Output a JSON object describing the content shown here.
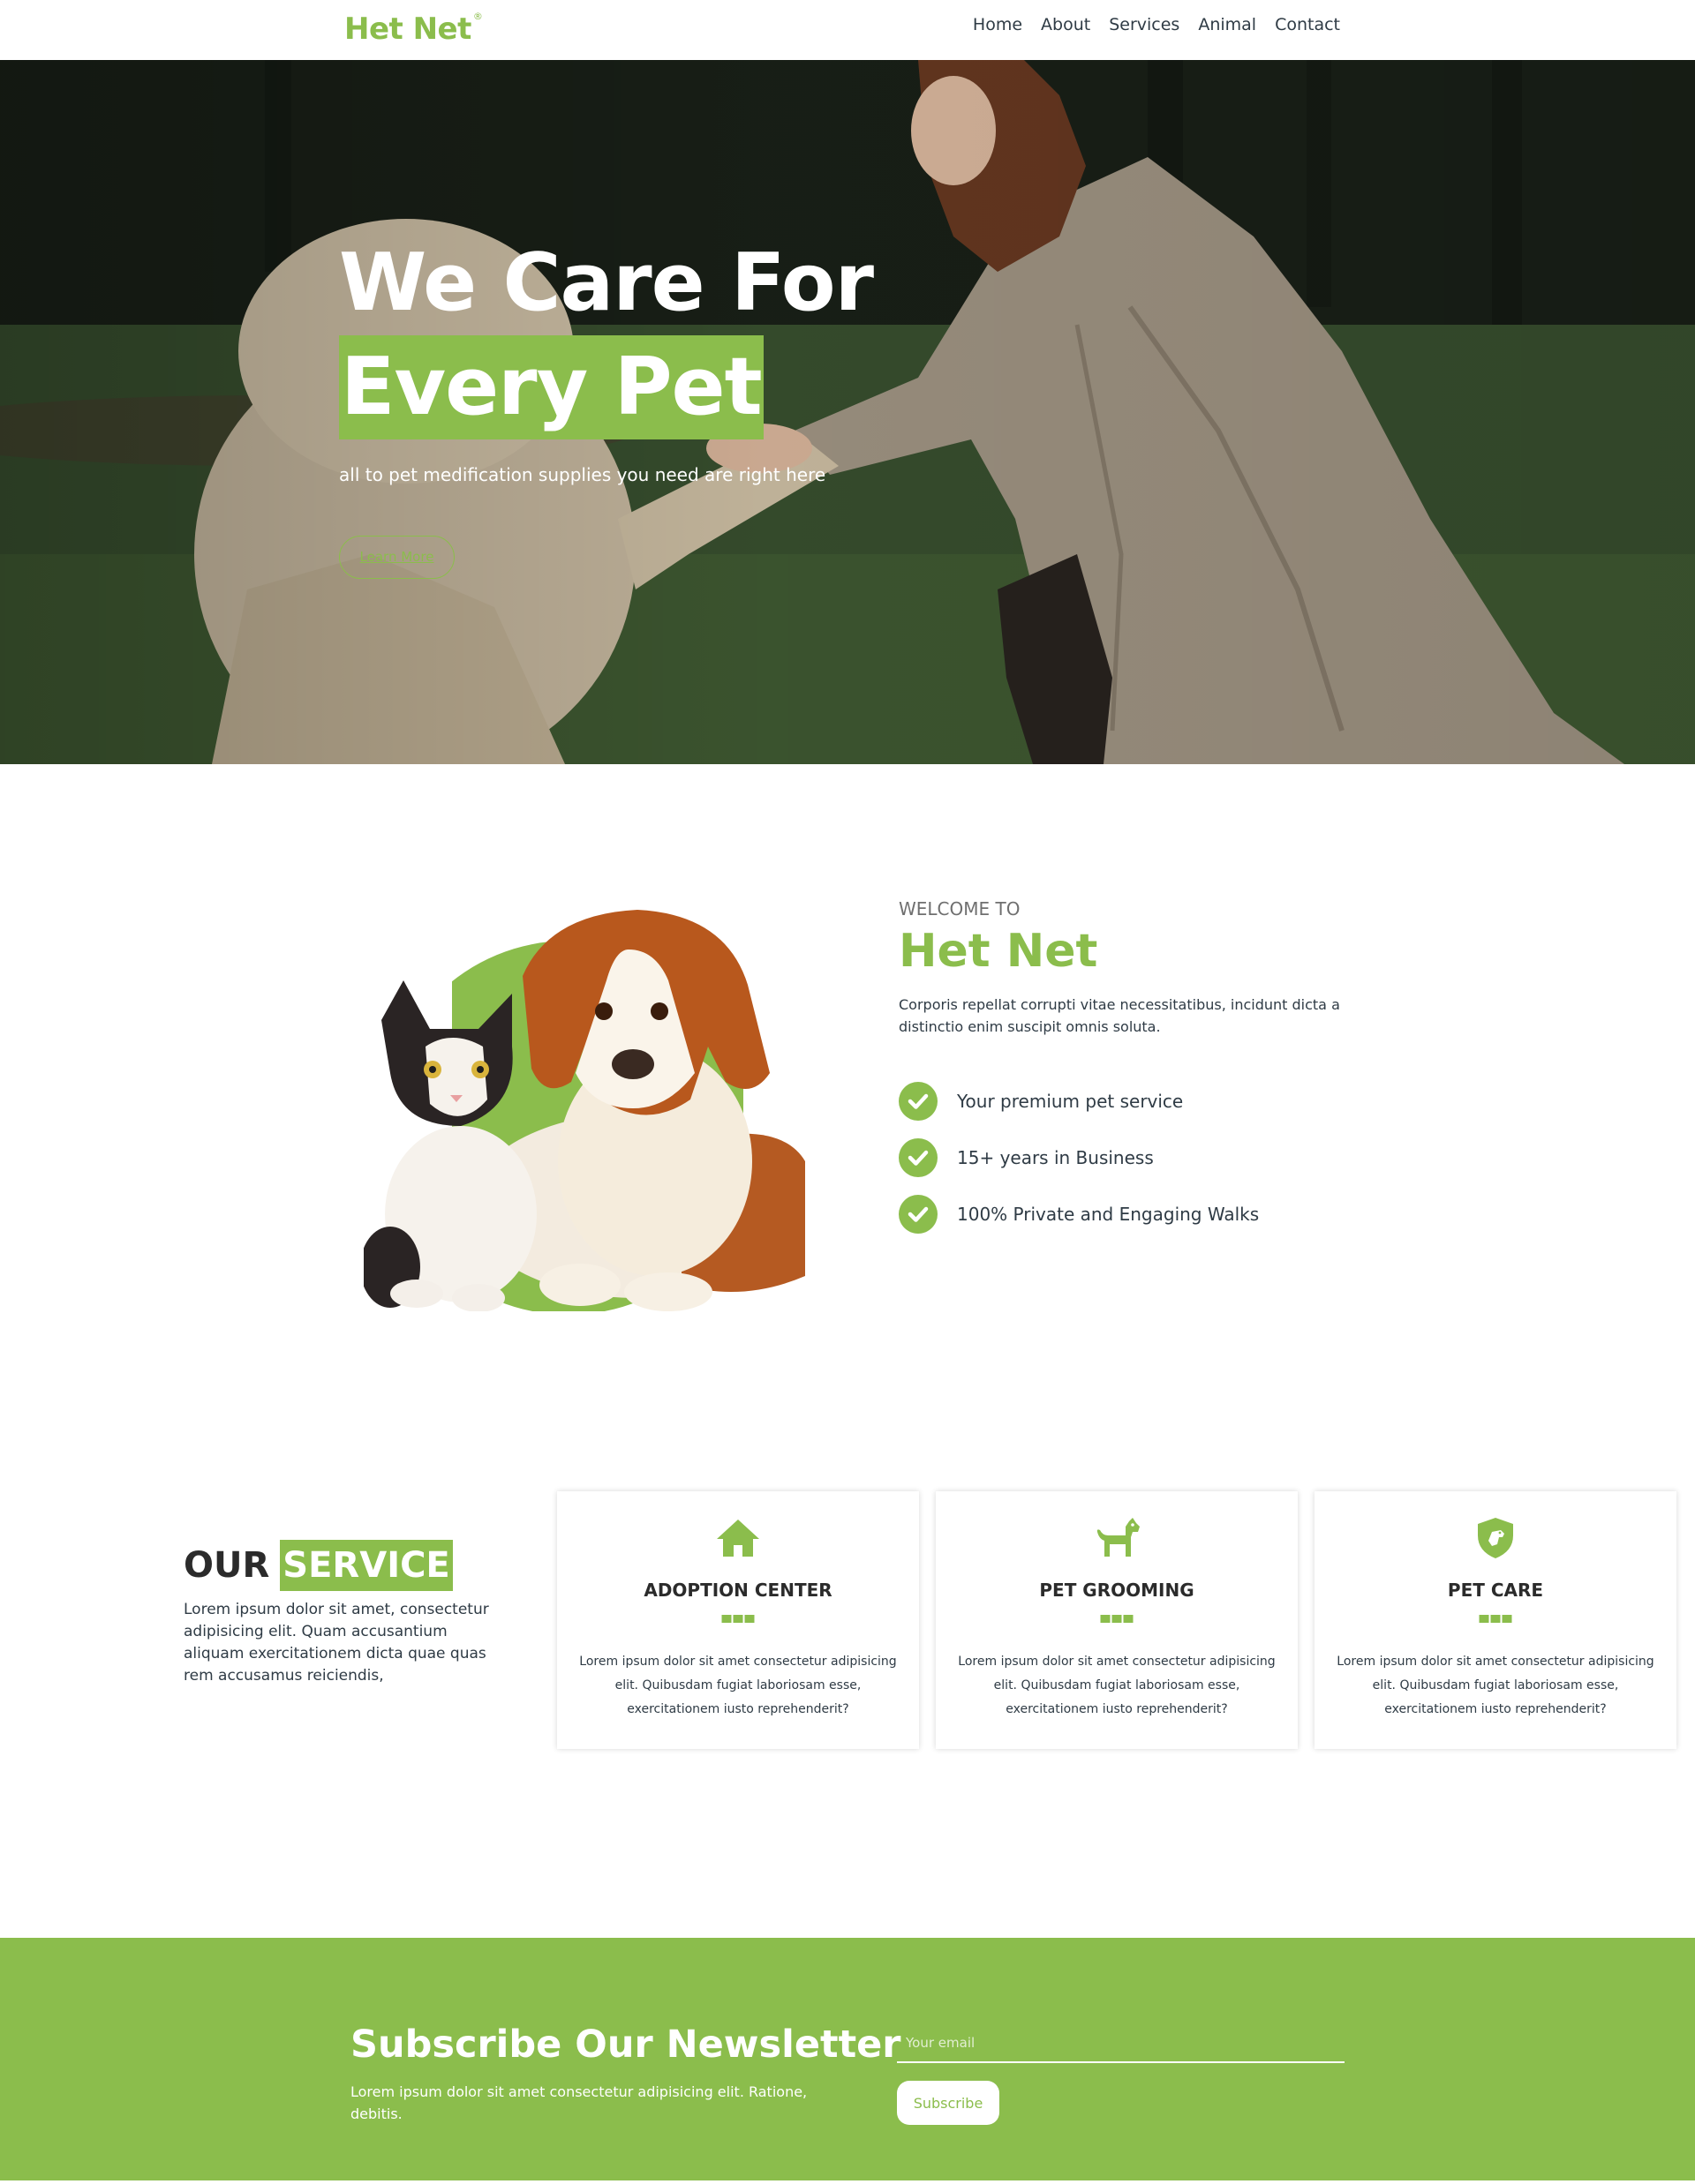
{
  "brand": {
    "name": "Het Net",
    "mark": "®",
    "accent": "#8bbd4c"
  },
  "nav": {
    "items": [
      "Home",
      "About",
      "Services",
      "Animal",
      "Contact"
    ]
  },
  "hero": {
    "title_line1": "We Care For",
    "title_line2": "Every Pet",
    "subtitle": "all to pet medification supplies you need are right here",
    "button": "Learn More"
  },
  "welcome": {
    "label": "WELCOME TO",
    "title": "Het Net",
    "description": "Corporis repellat corrupti vitae necessitatibus, incidunt dicta a distinctio enim suscipit omnis soluta.",
    "features": [
      "Your premium pet service",
      "15+ years in Business",
      "100% Private and Engaging Walks"
    ]
  },
  "services": {
    "title_word1": "OUR",
    "title_word2": "SERVICE",
    "description": "Lorem ipsum dolor sit amet, consectetur adipisicing elit. Quam accusantium aliquam exercitationem dicta quae quas rem accusamus reiciendis,",
    "cards": [
      {
        "icon": "house-icon",
        "title": "ADOPTION CENTER",
        "description": "Lorem ipsum dolor sit amet consectetur adipisicing elit. Quibusdam fugiat laboriosam esse, exercitationem iusto reprehenderit?"
      },
      {
        "icon": "dog-icon",
        "title": "PET GROOMING",
        "description": "Lorem ipsum dolor sit amet consectetur adipisicing elit. Quibusdam fugiat laboriosam esse, exercitationem iusto reprehenderit?"
      },
      {
        "icon": "shield-dog-icon",
        "title": "PET CARE",
        "description": "Lorem ipsum dolor sit amet consectetur adipisicing elit. Quibusdam fugiat laboriosam esse, exercitationem iusto reprehenderit?"
      }
    ]
  },
  "newsletter": {
    "title": "Subscribe Our Newsletter",
    "description": "Lorem ipsum dolor sit amet consectetur adipisicing elit. Ratione, debitis.",
    "email_placeholder": "Your email",
    "button": "Subscribe"
  }
}
